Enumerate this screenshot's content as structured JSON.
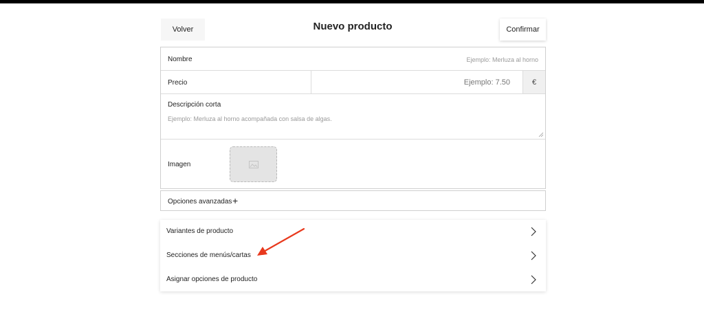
{
  "header": {
    "back_label": "Volver",
    "title": "Nuevo producto",
    "confirm_label": "Confirmar"
  },
  "form": {
    "name": {
      "label": "Nombre",
      "placeholder": "Ejemplo: Merluza al horno"
    },
    "price": {
      "label": "Precio",
      "placeholder": "Ejemplo: 7.50",
      "currency": "€"
    },
    "description": {
      "label": "Descripción corta",
      "placeholder": "Ejemplo: Merluza al horno acompañada con salsa de algas."
    },
    "image": {
      "label": "Imagen",
      "icon": "image-placeholder-icon"
    }
  },
  "advanced": {
    "label": "Opciones avanzadas",
    "icon": "plus-icon"
  },
  "links": [
    {
      "label": "Variantes de producto",
      "icon": "chevron-right-icon"
    },
    {
      "label": "Secciones de menús/cartas",
      "icon": "chevron-right-icon"
    },
    {
      "label": "Asignar opciones de producto",
      "icon": "chevron-right-icon"
    }
  ],
  "annotation": {
    "icon": "red-arrow-icon",
    "color": "#e8391d"
  },
  "colors": {
    "top_bar": "#000000",
    "addon_bg": "#f0f0f0",
    "dropzone_bg": "#e4e4e4"
  }
}
